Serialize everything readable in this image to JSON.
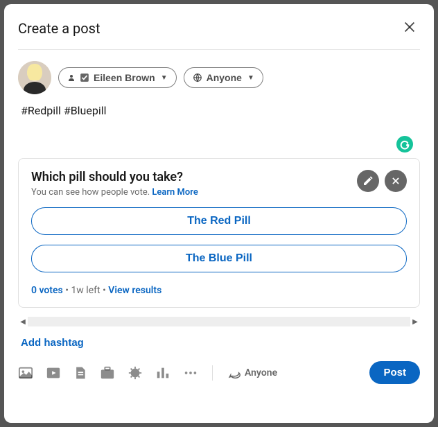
{
  "header": {
    "title": "Create a post"
  },
  "author": {
    "name": "Eileen Brown",
    "visibility": "Anyone"
  },
  "post": {
    "text": "#Redpill #Bluepill"
  },
  "poll": {
    "question": "Which pill should you take?",
    "subtext": "You can see how people vote. ",
    "learn_more": "Learn More",
    "options": [
      "The Red Pill",
      "The Blue Pill"
    ],
    "votes_label": "0 votes",
    "time_left": "1w left",
    "view_results": "View results"
  },
  "hashtag": {
    "add_label": "Add hashtag"
  },
  "toolbar": {
    "comment_visibility": "Anyone",
    "post_label": "Post"
  }
}
